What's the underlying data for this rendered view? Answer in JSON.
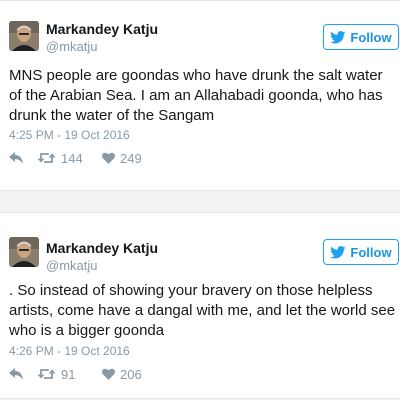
{
  "follow_label": "Follow",
  "colors": {
    "accent": "#1da1f2",
    "name": "#14171a",
    "meta": "#8899a6"
  },
  "tweets": [
    {
      "author": "Markandey Katju",
      "handle": "@mkatju",
      "text": "MNS people are goondas who have drunk the salt water of the Arabian Sea. I am an Allahabadi goonda, who has drunk the water of the Sangam",
      "timestamp": "4:25 PM - 19 Oct 2016",
      "retweets": "144",
      "likes": "249"
    },
    {
      "author": "Markandey Katju",
      "handle": "@mkatju",
      "text": ". So instead of showing your bravery on those helpless artists, come have a dangal with me, and let the world see who is a bigger goonda",
      "timestamp": "4:26 PM - 19 Oct 2016",
      "retweets": "91",
      "likes": "206"
    }
  ]
}
